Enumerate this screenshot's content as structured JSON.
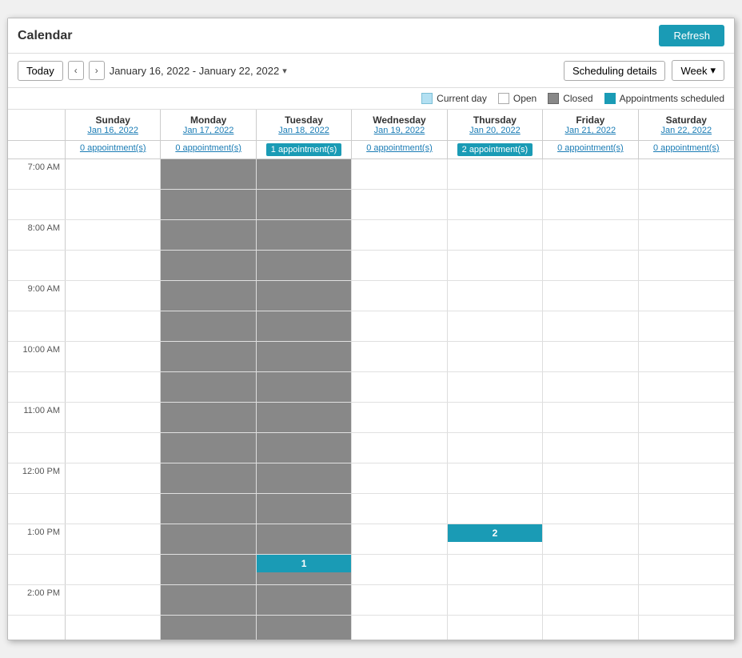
{
  "window": {
    "title": "Calendar"
  },
  "toolbar": {
    "today_label": "Today",
    "prev_icon": "‹",
    "next_icon": "›",
    "date_range": "January 16, 2022 - January 22, 2022",
    "date_range_chevron": "▾",
    "scheduling_label": "Scheduling details",
    "week_label": "Week",
    "week_chevron": "▾"
  },
  "refresh_label": "Refresh",
  "legend": {
    "current_day_label": "Current day",
    "open_label": "Open",
    "closed_label": "Closed",
    "appointments_label": "Appointments scheduled"
  },
  "days": [
    {
      "name": "Sunday",
      "date": "Jan 16, 2022",
      "appt_count": "0 appointment(s)",
      "appt_type": "link"
    },
    {
      "name": "Monday",
      "date": "Jan 17, 2022",
      "appt_count": "0 appointment(s)",
      "appt_type": "link"
    },
    {
      "name": "Tuesday",
      "date": "Jan 18, 2022",
      "appt_count": "1 appointment(s)",
      "appt_type": "badge"
    },
    {
      "name": "Wednesday",
      "date": "Jan 19, 2022",
      "appt_count": "0 appointment(s)",
      "appt_type": "link"
    },
    {
      "name": "Thursday",
      "date": "Jan 20, 2022",
      "appt_count": "2 appointment(s)",
      "appt_type": "badge"
    },
    {
      "name": "Friday",
      "date": "Jan 21, 2022",
      "appt_count": "0 appointment(s)",
      "appt_type": "link"
    },
    {
      "name": "Saturday",
      "date": "Jan 22, 2022",
      "appt_count": "0 appointment(s)",
      "appt_type": "link"
    }
  ],
  "time_slots": [
    {
      "label": "7:00 AM",
      "show_label": true
    },
    {
      "label": "",
      "show_label": false
    },
    {
      "label": "8:00 AM",
      "show_label": true
    },
    {
      "label": "",
      "show_label": false
    },
    {
      "label": "9:00 AM",
      "show_label": true
    },
    {
      "label": "",
      "show_label": false
    },
    {
      "label": "10:00 AM",
      "show_label": true
    },
    {
      "label": "",
      "show_label": false
    },
    {
      "label": "11:00 AM",
      "show_label": true
    },
    {
      "label": "",
      "show_label": false
    },
    {
      "label": "12:00 PM",
      "show_label": true
    },
    {
      "label": "",
      "show_label": false
    },
    {
      "label": "1:00 PM",
      "show_label": true
    },
    {
      "label": "",
      "show_label": false
    },
    {
      "label": "2:00 PM",
      "show_label": true
    },
    {
      "label": "",
      "show_label": false
    }
  ],
  "cell_states": {
    "closed_days": [
      1,
      2
    ],
    "appt_blocks": [
      {
        "day_index": 2,
        "slot_index": 13,
        "label": "1"
      },
      {
        "day_index": 4,
        "slot_index": 12,
        "label": "2"
      }
    ]
  }
}
